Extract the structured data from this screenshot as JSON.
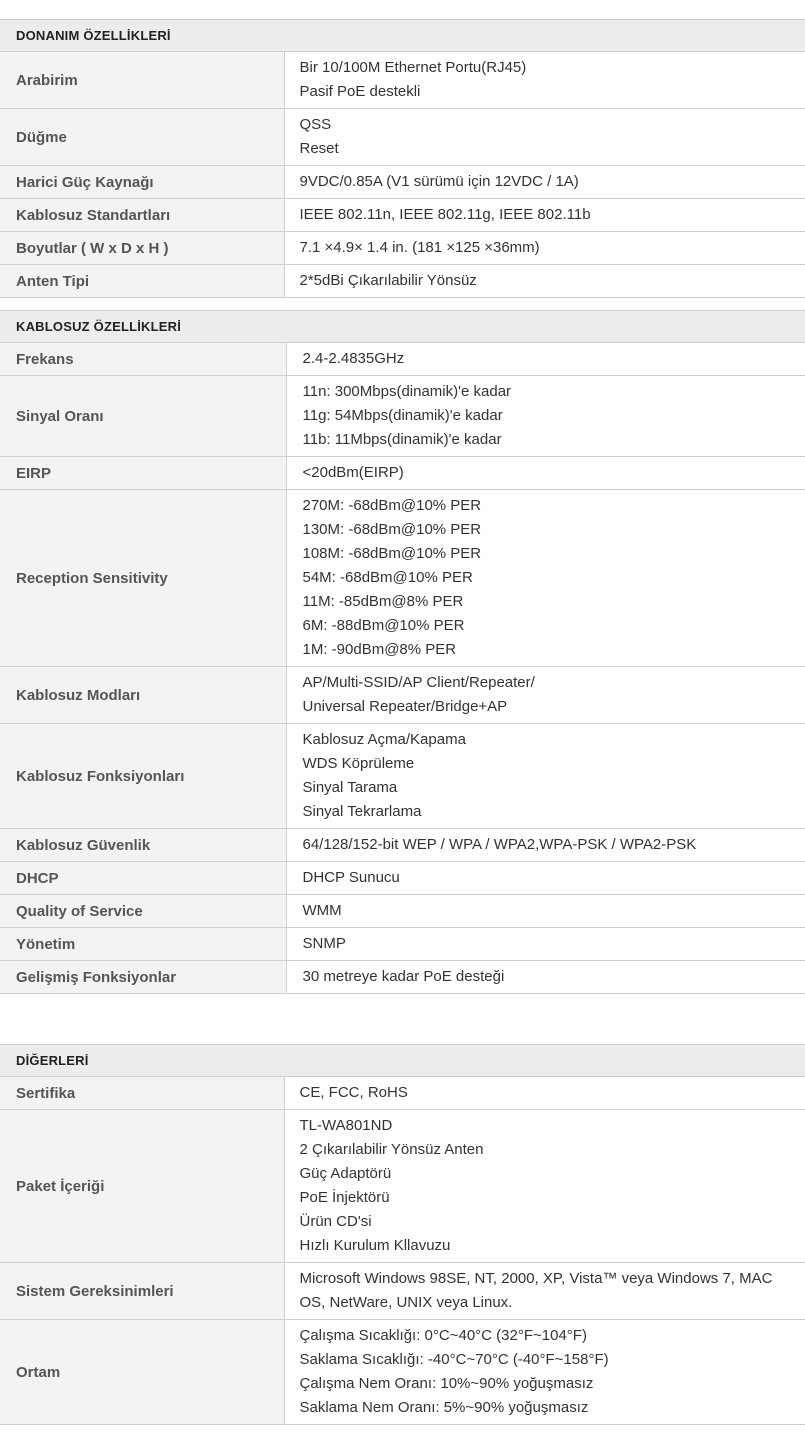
{
  "sections": [
    {
      "title": "DONANIM ÖZELLİKLERİ",
      "rows": [
        {
          "label": "Arabirim",
          "lines": [
            "Bir 10/100M Ethernet Portu(RJ45)",
            "Pasif PoE destekli"
          ]
        },
        {
          "label": "Düğme",
          "lines": [
            "QSS",
            "Reset"
          ]
        },
        {
          "label": "Harici Güç Kaynağı",
          "lines": [
            "9VDC/0.85A (V1 sürümü için 12VDC / 1A)"
          ]
        },
        {
          "label": "Kablosuz Standartları",
          "lines": [
            "IEEE 802.11n, IEEE 802.11g, IEEE 802.11b"
          ]
        },
        {
          "label": "Boyutlar ( W x D x H )",
          "lines": [
            "7.1 ×4.9× 1.4 in. (181 ×125 ×36mm)"
          ]
        },
        {
          "label": "Anten Tipi",
          "lines": [
            "2*5dBi Çıkarılabilir Yönsüz"
          ]
        }
      ]
    },
    {
      "title": "KABLOSUZ ÖZELLİKLERİ",
      "rows": [
        {
          "label": "Frekans",
          "lines": [
            "2.4-2.4835GHz"
          ]
        },
        {
          "label": "Sinyal Oranı",
          "lines": [
            "11n: 300Mbps(dinamik)'e kadar",
            "11g: 54Mbps(dinamik)'e kadar",
            "11b: 11Mbps(dinamik)'e kadar"
          ]
        },
        {
          "label": "EIRP",
          "lines": [
            "<20dBm(EIRP)"
          ]
        },
        {
          "label": "Reception Sensitivity",
          "lines": [
            "270M: -68dBm@10% PER",
            "130M: -68dBm@10% PER",
            "108M: -68dBm@10% PER",
            "54M: -68dBm@10% PER",
            "11M: -85dBm@8% PER",
            "6M: -88dBm@10% PER",
            "1M: -90dBm@8% PER"
          ]
        },
        {
          "label": "Kablosuz Modları",
          "lines": [
            "AP/Multi-SSID/AP Client/Repeater/",
            "Universal Repeater/Bridge+AP"
          ]
        },
        {
          "label": "Kablosuz Fonksiyonları",
          "lines": [
            "Kablosuz Açma/Kapama",
            "WDS Köprüleme",
            "Sinyal Tarama",
            "Sinyal Tekrarlama"
          ]
        },
        {
          "label": "Kablosuz Güvenlik",
          "lines": [
            "64/128/152-bit WEP / WPA / WPA2,WPA-PSK / WPA2-PSK"
          ]
        },
        {
          "label": "DHCP",
          "lines": [
            "DHCP Sunucu"
          ]
        },
        {
          "label": "Quality of Service",
          "lines": [
            "WMM"
          ]
        },
        {
          "label": "Yönetim",
          "lines": [
            "SNMP"
          ]
        },
        {
          "label": "Gelişmiş Fonksiyonlar",
          "lines": [
            "30 metreye kadar PoE desteği"
          ]
        }
      ]
    },
    {
      "title": "DİĞERLERİ",
      "rows": [
        {
          "label": "Sertifika",
          "lines": [
            "CE, FCC, RoHS"
          ]
        },
        {
          "label": "Paket İçeriği",
          "lines": [
            "TL-WA801ND",
            "2 Çıkarılabilir Yönsüz Anten",
            "Güç Adaptörü",
            "PoE İnjektörü",
            "Ürün CD'si",
            "Hızlı Kurulum Kllavuzu"
          ]
        },
        {
          "label": "Sistem Gereksinimleri",
          "lines": [
            "Microsoft Windows 98SE, NT, 2000, XP, Vista™ veya Windows 7, MAC",
            "OS, NetWare, UNIX veya Linux."
          ]
        },
        {
          "label": "Ortam",
          "lines": [
            "Çalışma Sıcaklığı: 0°C~40°C (32°F~104°F)",
            "Saklama Sıcaklığı: -40°C~70°C (-40°F~158°F)",
            "Çalışma Nem Oranı: 10%~90% yoğuşmasız",
            "Saklama Nem Oranı: 5%~90% yoğuşmasız"
          ]
        }
      ]
    }
  ]
}
